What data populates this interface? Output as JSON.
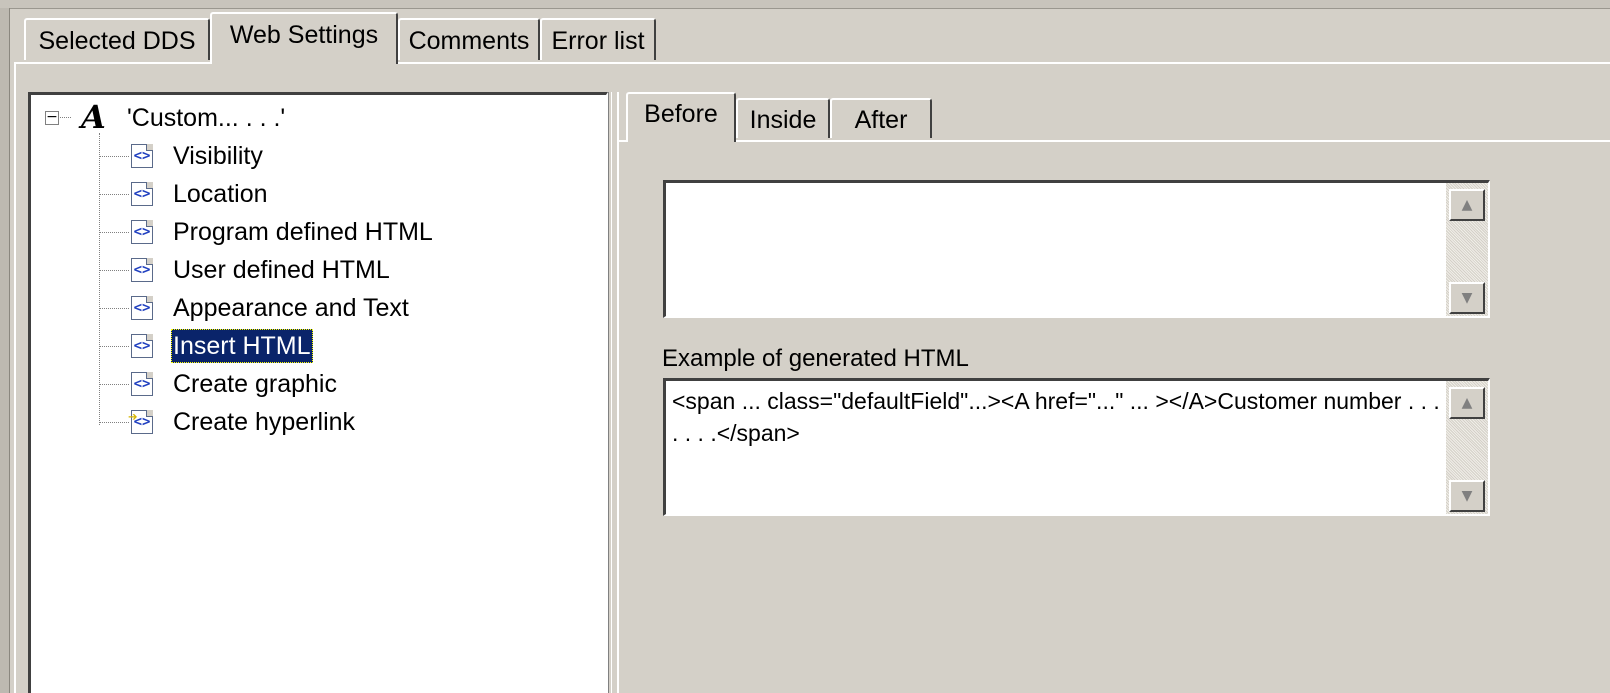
{
  "tabs": [
    {
      "label": "Selected DDS",
      "active": false
    },
    {
      "label": "Web Settings",
      "active": true
    },
    {
      "label": "Comments",
      "active": false
    },
    {
      "label": "Error list",
      "active": false
    }
  ],
  "tree": {
    "root": {
      "label": "'Custom... . . .'",
      "icon": "text-style-A-icon",
      "expanded": true
    },
    "items": [
      {
        "label": "Visibility",
        "icon": "html-tag-icon"
      },
      {
        "label": "Location",
        "icon": "html-tag-icon"
      },
      {
        "label": "Program defined HTML",
        "icon": "html-tag-icon"
      },
      {
        "label": "User defined HTML",
        "icon": "html-tag-icon"
      },
      {
        "label": "Appearance and Text",
        "icon": "html-tag-icon"
      },
      {
        "label": "Insert HTML",
        "icon": "html-tag-icon",
        "selected": true
      },
      {
        "label": "Create graphic",
        "icon": "html-tag-icon"
      },
      {
        "label": "Create hyperlink",
        "icon": "hyperlink-icon"
      }
    ]
  },
  "subtabs": [
    {
      "label": "Before",
      "active": true
    },
    {
      "label": "Inside",
      "active": false
    },
    {
      "label": "After",
      "active": false
    }
  ],
  "html_input": {
    "value": ""
  },
  "example": {
    "label": "Example of generated HTML",
    "value": "<span ... class=\"defaultField\"...><A href=\"...\" ... ></A>Customer number . . . . . . .</span>"
  },
  "scroll_up_glyph": "▲",
  "scroll_down_glyph": "▼",
  "colors": {
    "selection": "#0a246a",
    "window_face": "#d4d0c8"
  }
}
